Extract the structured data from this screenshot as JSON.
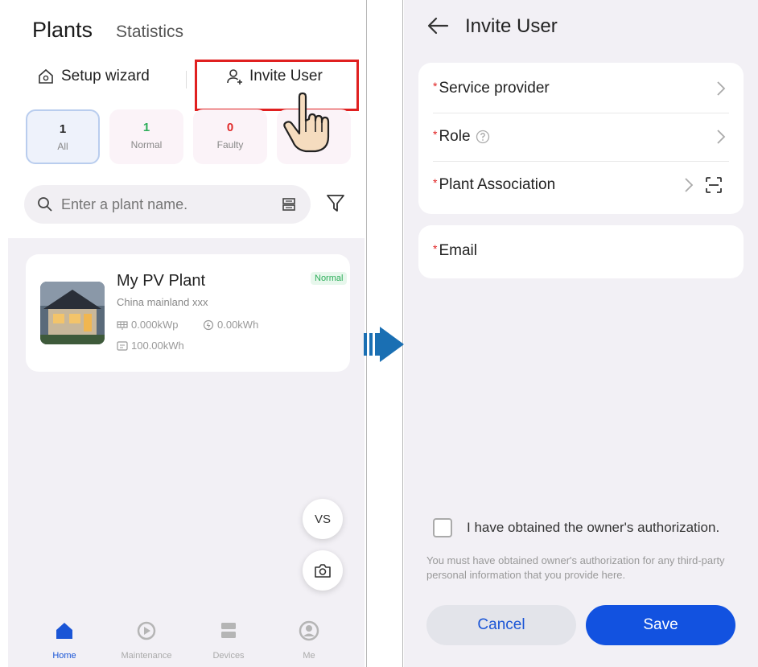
{
  "plants_screen": {
    "tabs": {
      "plants": "Plants",
      "statistics": "Statistics"
    },
    "toolbar": {
      "setup_wizard": "Setup wizard",
      "invite_user": "Invite User"
    },
    "filters": [
      {
        "count": "1",
        "label": "All"
      },
      {
        "count": "1",
        "label": "Normal"
      },
      {
        "count": "0",
        "label": "Faulty"
      },
      {
        "count": "",
        "label": ""
      }
    ],
    "search": {
      "placeholder": "Enter a plant name."
    },
    "plant": {
      "name": "My PV Plant",
      "region": "China mainland xxx",
      "status": "Normal",
      "capacity": "0.000kWp",
      "daily_yield": "0.00kWh",
      "total_yield": "100.00kWh"
    },
    "fab": {
      "vs": "VS"
    },
    "nav": [
      {
        "label": "Home",
        "icon": "home-icon"
      },
      {
        "label": "Maintenance",
        "icon": "maintenance-icon"
      },
      {
        "label": "Devices",
        "icon": "devices-icon"
      },
      {
        "label": "Me",
        "icon": "me-icon"
      }
    ]
  },
  "invite_screen": {
    "title": "Invite User",
    "required_mark": "*",
    "fields": {
      "service_provider": "Service provider",
      "role": "Role",
      "plant_association": "Plant Association",
      "email": "Email"
    },
    "authorization": {
      "checkbox_label": "I have obtained the owner's authorization.",
      "note": "You must have obtained owner's authorization for any third-party personal information that you provide here."
    },
    "buttons": {
      "cancel": "Cancel",
      "save": "Save"
    }
  },
  "colors": {
    "primary": "#1252e0",
    "required": "#e02020",
    "normal": "#2dae5a",
    "faulty": "#e02a2a",
    "highlight": "#e02020",
    "flow_arrow": "#1a6fb3"
  }
}
